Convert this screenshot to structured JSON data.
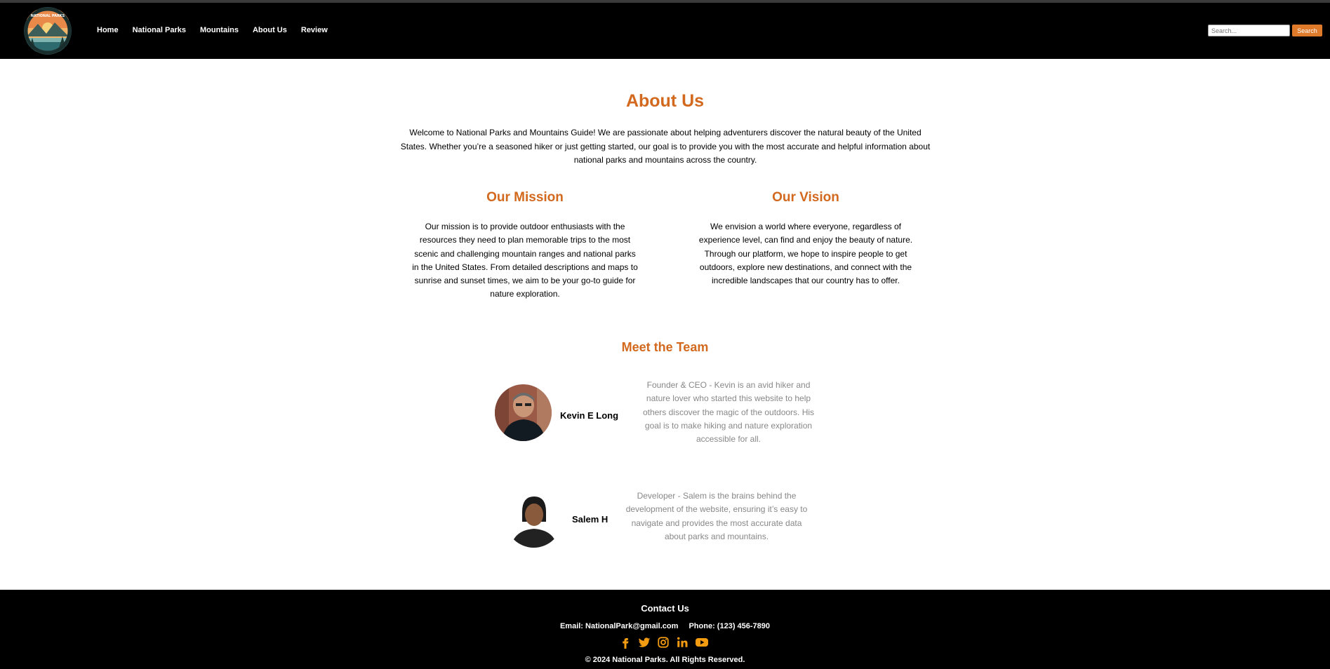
{
  "header": {
    "logo_text": "NATIONAL PARKS",
    "nav": [
      "Home",
      "National Parks",
      "Mountains",
      "About Us",
      "Review"
    ],
    "search_placeholder": "Search...",
    "search_button": "Search"
  },
  "main": {
    "title": "About Us",
    "intro": "Welcome to National Parks and Mountains Guide! We are passionate about helping adventurers discover the natural beauty of the United States. Whether you’re a seasoned hiker or just getting started, our goal is to provide you with the most accurate and helpful information about national parks and mountains across the country.",
    "mission": {
      "title": "Our Mission",
      "text": "Our mission is to provide outdoor enthusiasts with the resources they need to plan memorable trips to the most scenic and challenging mountain ranges and national parks in the United States. From detailed descriptions and maps to sunrise and sunset times, we aim to be your go-to guide for nature exploration."
    },
    "vision": {
      "title": "Our Vision",
      "text": "We envision a world where everyone, regardless of experience level, can find and enjoy the beauty of nature. Through our platform, we hope to inspire people to get outdoors, explore new destinations, and connect with the incredible landscapes that our country has to offer."
    },
    "team": {
      "title": "Meet the Team",
      "members": [
        {
          "name": "Kevin E Long",
          "bio": "Founder & CEO - Kevin is an avid hiker and nature lover who started this website to help others discover the magic of the outdoors. His goal is to make hiking and nature exploration accessible for all."
        },
        {
          "name": "Salem H",
          "bio": "Developer - Salem is the brains behind the development of the website, ensuring it’s easy to navigate and provides the most accurate data about parks and mountains."
        }
      ]
    }
  },
  "footer": {
    "contact_title": "Contact Us",
    "email": "Email: NationalPark@gmail.com",
    "phone": "Phone: (123) 456-7890",
    "social_icons": [
      "facebook-icon",
      "twitter-icon",
      "instagram-icon",
      "linkedin-icon",
      "youtube-icon"
    ],
    "copyright": "© 2024 National Parks. All Rights Reserved."
  },
  "colors": {
    "accent": "#d2691e",
    "search_button": "#e07a2b",
    "social_icon": "#f39c12",
    "header_bg": "#000000",
    "bio_text": "#888888"
  }
}
